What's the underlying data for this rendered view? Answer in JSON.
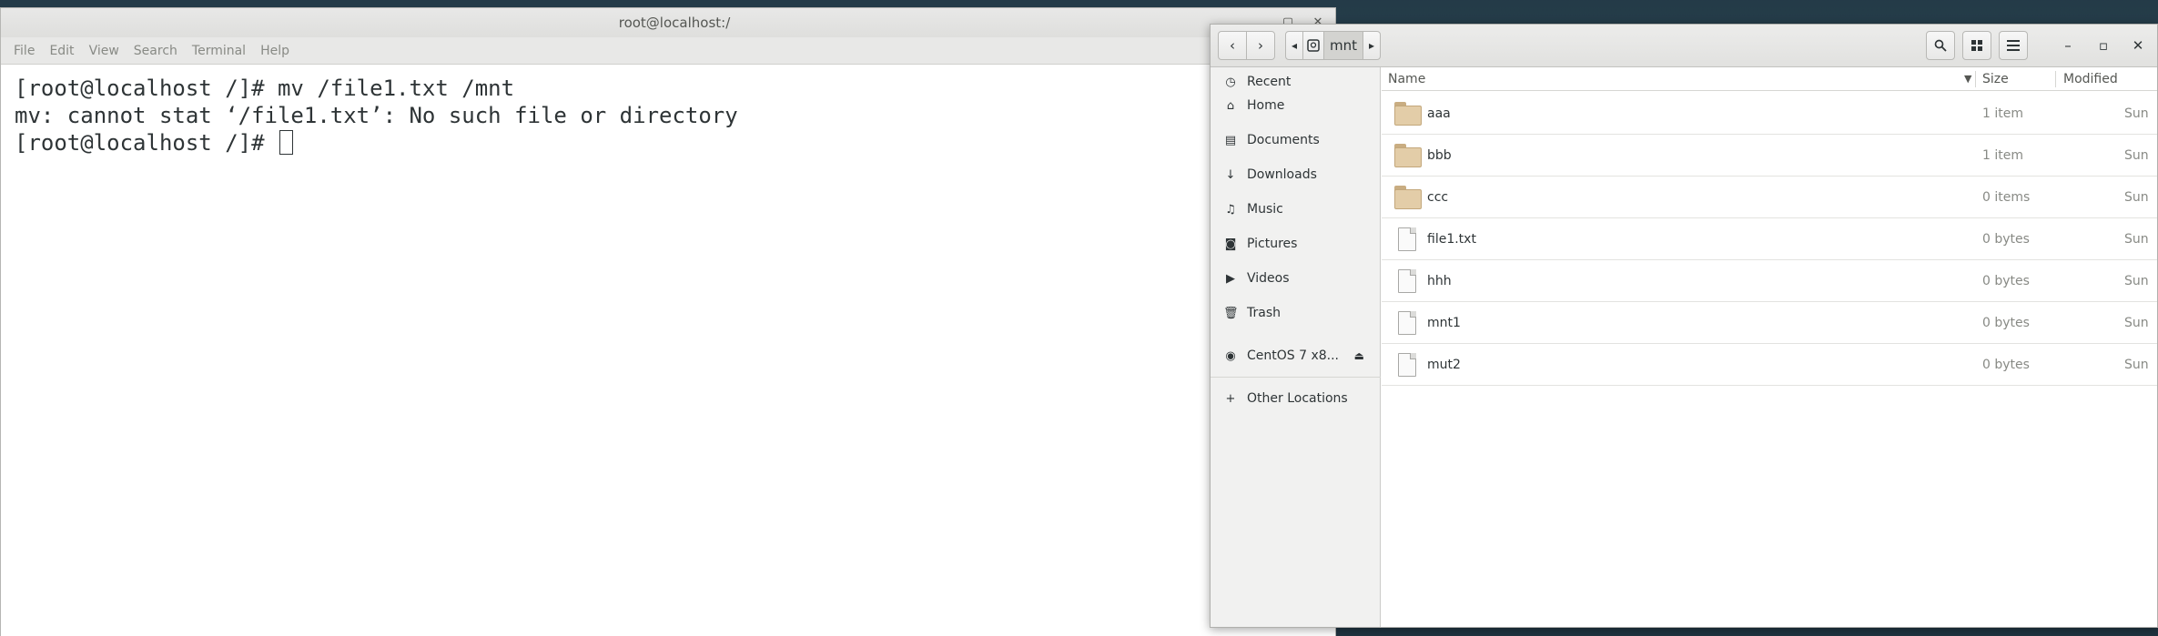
{
  "terminal": {
    "title": "root@localhost:/",
    "menu": [
      "File",
      "Edit",
      "View",
      "Search",
      "Terminal",
      "Help"
    ],
    "lines": [
      "[root@localhost /]# mv /file1.txt /mnt",
      "mv: cannot stat ‘/file1.txt’: No such file or directory",
      "[root@localhost /]# "
    ]
  },
  "files": {
    "path": {
      "current": "mnt"
    },
    "sidebar": [
      {
        "label": "Recent",
        "icon": "clock-icon"
      },
      {
        "label": "Home",
        "icon": "home-icon"
      },
      {
        "label": "Documents",
        "icon": "document-icon"
      },
      {
        "label": "Downloads",
        "icon": "download-icon"
      },
      {
        "label": "Music",
        "icon": "music-icon"
      },
      {
        "label": "Pictures",
        "icon": "camera-icon"
      },
      {
        "label": "Videos",
        "icon": "video-icon"
      },
      {
        "label": "Trash",
        "icon": "trash-icon"
      }
    ],
    "devices": [
      {
        "label": "CentOS 7 x8...",
        "icon": "disc-icon"
      }
    ],
    "other_locations": "Other Locations",
    "columns": {
      "name": "Name",
      "size": "Size",
      "modified": "Modified"
    },
    "rows": [
      {
        "name": "aaa",
        "size": "1 item",
        "modified": "Sun",
        "type": "folder"
      },
      {
        "name": "bbb",
        "size": "1 item",
        "modified": "Sun",
        "type": "folder"
      },
      {
        "name": "ccc",
        "size": "0 items",
        "modified": "Sun",
        "type": "folder"
      },
      {
        "name": "file1.txt",
        "size": "0 bytes",
        "modified": "Sun",
        "type": "file"
      },
      {
        "name": "hhh",
        "size": "0 bytes",
        "modified": "Sun",
        "type": "file"
      },
      {
        "name": "mnt1",
        "size": "0 bytes",
        "modified": "Sun",
        "type": "file"
      },
      {
        "name": "mut2",
        "size": "0 bytes",
        "modified": "Sun",
        "type": "file"
      }
    ]
  }
}
